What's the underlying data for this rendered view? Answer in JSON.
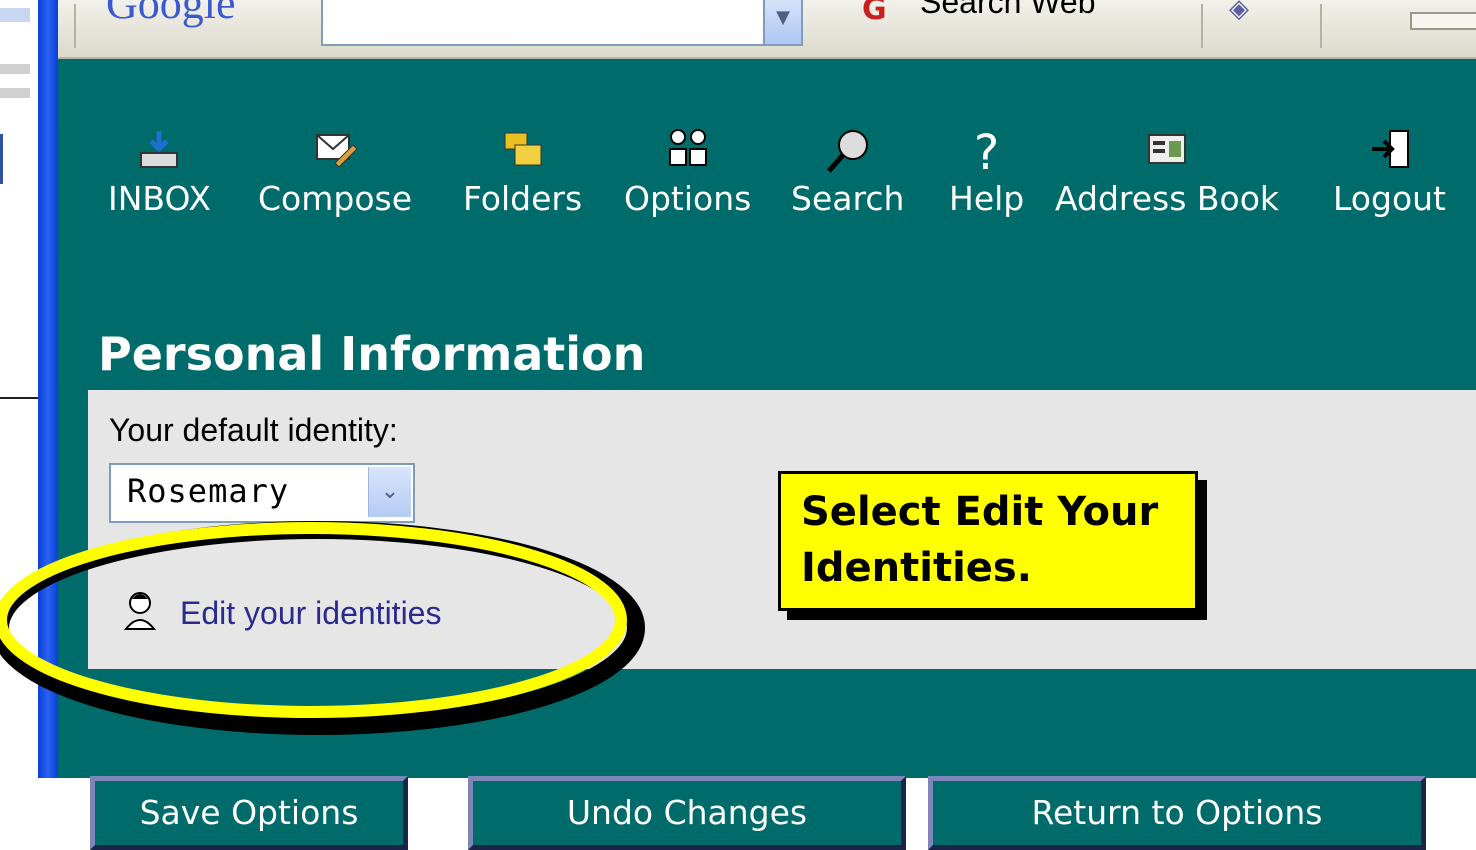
{
  "browser_toolbar": {
    "google_logo": "Google",
    "search_dropdown_arrow": "▼",
    "search_web_label": "Search Web",
    "search_web_icon": "search-web-icon"
  },
  "nav": {
    "items": [
      {
        "label": "INBOX",
        "icon": "inbox-icon"
      },
      {
        "label": "Compose",
        "icon": "compose-icon"
      },
      {
        "label": "Folders",
        "icon": "folders-icon"
      },
      {
        "label": "Options",
        "icon": "options-icon"
      },
      {
        "label": "Search",
        "icon": "search-icon"
      },
      {
        "label": "Help",
        "icon": "help-icon"
      },
      {
        "label": "Address Book",
        "icon": "address-book-icon"
      },
      {
        "label": "Logout",
        "icon": "logout-icon"
      }
    ]
  },
  "section": {
    "title": "Personal Information",
    "identity_label": "Your default identity:",
    "identity_value": "Rosemary",
    "identity_arrow": "⌄",
    "edit_link": "Edit your identities"
  },
  "callout": {
    "text": "Select Edit Your Identities."
  },
  "buttons": {
    "save": "Save Options",
    "undo": "Undo Changes",
    "return": "Return to Options"
  },
  "colors": {
    "main_bg": "#006b6b",
    "panel_bg": "#e6e6e6",
    "callout_bg": "#ffff00",
    "ellipse_stroke": "#ffff00",
    "link": "#2a2a8f"
  }
}
